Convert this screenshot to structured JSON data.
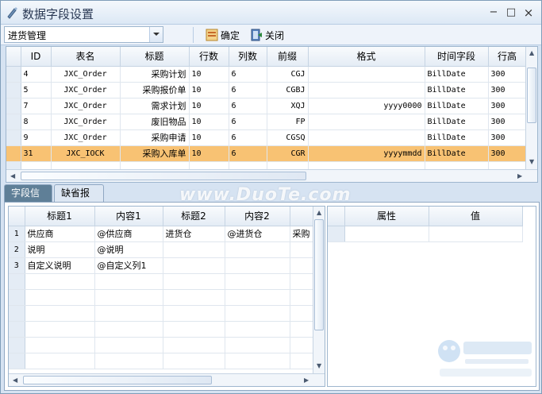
{
  "window": {
    "title": "数据字段设置",
    "controls": {
      "minimize": "−",
      "maximize": "□",
      "close": "×"
    }
  },
  "toolbar": {
    "combo_value": "进货管理",
    "confirm_label": "确定",
    "close_label": "关闭"
  },
  "top_grid": {
    "headers": [
      "ID",
      "表名",
      "标题",
      "行数",
      "列数",
      "前缀",
      "格式",
      "时间字段",
      "行高"
    ],
    "rows": [
      [
        "4",
        "JXC_Order",
        "采购计划",
        "10",
        "6",
        "CGJ",
        "",
        "BillDate",
        "300"
      ],
      [
        "5",
        "JXC_Order",
        "采购报价单",
        "10",
        "6",
        "CGBJ",
        "",
        "BillDate",
        "300"
      ],
      [
        "7",
        "JXC_Order",
        "需求计划",
        "10",
        "6",
        "XQJ",
        "yyyy0000",
        "BillDate",
        "300"
      ],
      [
        "8",
        "JXC_Order",
        "废旧物品",
        "10",
        "6",
        "FP",
        "",
        "BillDate",
        "300"
      ],
      [
        "9",
        "JXC_Order",
        "采购申请",
        "10",
        "6",
        "CGSQ",
        "",
        "BillDate",
        "300"
      ],
      [
        "31",
        "JXC_IOCK",
        "采购入库单",
        "10",
        "6",
        "CGR",
        "yyyymmdd",
        "BillDate",
        "300"
      ]
    ],
    "selected_row": 5
  },
  "tabs": [
    "字段信息",
    "缺省报表"
  ],
  "field_grid": {
    "headers": [
      "标题1",
      "内容1",
      "标题2",
      "内容2",
      ""
    ],
    "rows": [
      [
        "1",
        "供应商",
        "@供应商",
        "进货仓",
        "@进货仓",
        "采购"
      ],
      [
        "2",
        "说明",
        "@说明",
        "",
        "",
        ""
      ],
      [
        "3",
        "自定义说明",
        "@自定义列1",
        "",
        "",
        ""
      ]
    ]
  },
  "prop_grid": {
    "headers": [
      "属性",
      "值"
    ]
  },
  "watermark": "www.DuoTe.com",
  "colors": {
    "selected_row": "#f8c273",
    "active_tab": "#5f7f97",
    "window_bg": "#d6e3f2"
  }
}
